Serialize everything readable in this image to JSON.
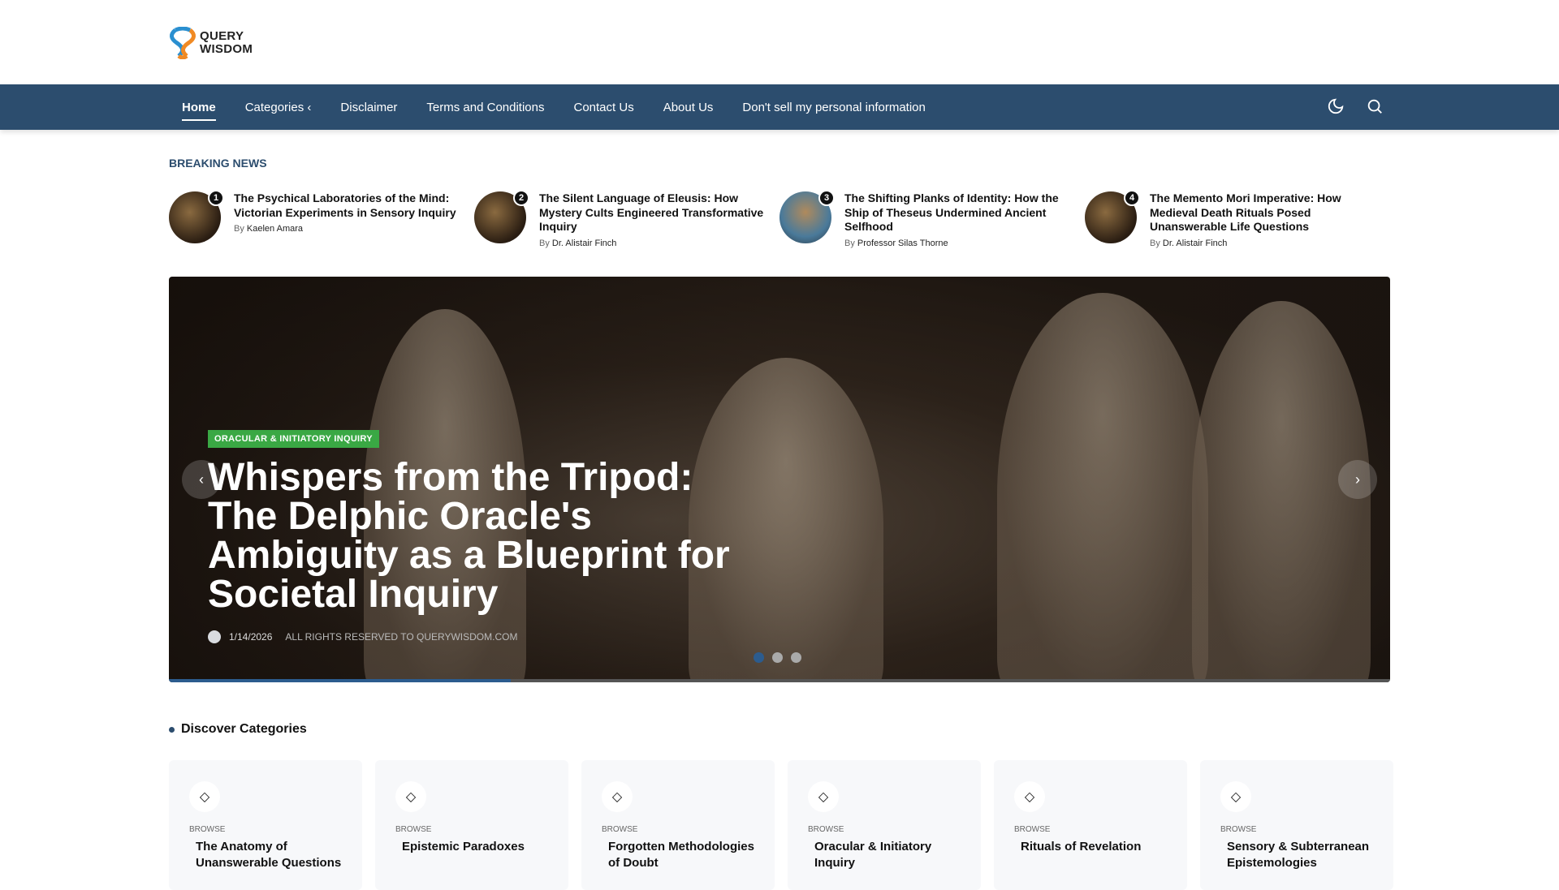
{
  "logo": {
    "line1": "QUERY",
    "line2": "WISDOM"
  },
  "nav": {
    "items": [
      "Home",
      "Categories",
      "Disclaimer",
      "Terms and Conditions",
      "Contact Us",
      "About Us",
      "Don't sell my personal information"
    ],
    "categories_chevron": "‹"
  },
  "breaking": {
    "label": "BREAKING NEWS",
    "by": "By",
    "items": [
      {
        "num": "1",
        "title": "The Psychical Laboratories of the Mind: Victorian Experiments in Sensory Inquiry",
        "author": "Kaelen Amara"
      },
      {
        "num": "2",
        "title": "The Silent Language of Eleusis: How Mystery Cults Engineered Transformative Inquiry",
        "author": "Dr. Alistair Finch"
      },
      {
        "num": "3",
        "title": "The Shifting Planks of Identity: How the Ship of Theseus Undermined Ancient Selfhood",
        "author": "Professor Silas Thorne"
      },
      {
        "num": "4",
        "title": "The Memento Mori Imperative: How Medieval Death Rituals Posed Unanswerable Life Questions",
        "author": "Dr. Alistair Finch"
      }
    ]
  },
  "hero": {
    "category": "ORACULAR & INITIATORY INQUIRY",
    "title": "Whispers from the Tripod: The Delphic Oracle's Ambiguity as a Blueprint for Societal Inquiry",
    "date": "1/14/2026",
    "rights": "ALL RIGHTS RESERVED TO QUERYWISDOM.COM",
    "prev": "‹",
    "next": "›",
    "slide_count": 3,
    "active_slide": 1,
    "progress": 0.28
  },
  "categories": {
    "title": "Discover Categories",
    "browse": "BROWSE",
    "items": [
      "The Anatomy of Unanswerable Questions",
      "Epistemic Paradoxes",
      "Forgotten Methodologies of Doubt",
      "Oracular & Initiatory Inquiry",
      "Rituals of Revelation",
      "Sensory & Subterranean Epistemologies"
    ]
  },
  "colors": {
    "nav": "#2c4d6e",
    "badge": "#3aa844",
    "accent": "#2c5c8e"
  }
}
